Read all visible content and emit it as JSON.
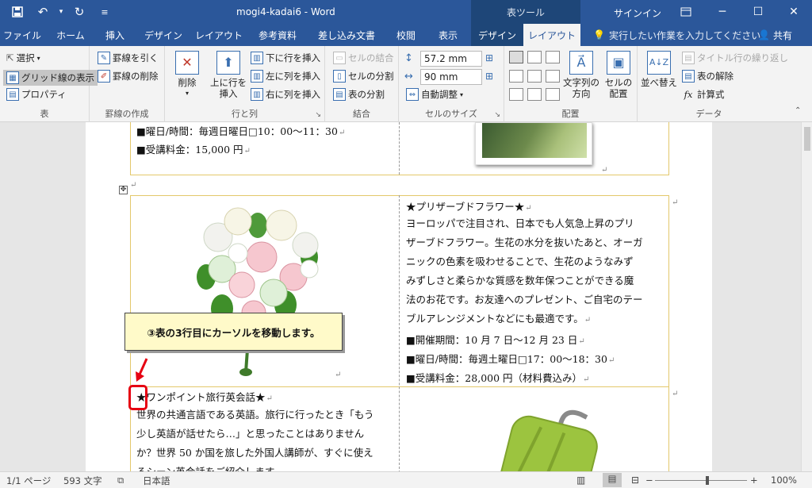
{
  "titlebar": {
    "doc_title": "mogi4-kadai6  -  Word",
    "context_group": "表ツール",
    "signin": "サインイン"
  },
  "tabs": [
    "ファイル",
    "ホーム",
    "挿入",
    "デザイン",
    "レイアウト",
    "参考資料",
    "差し込み文書",
    "校閲",
    "表示",
    "デザイン",
    "レイアウト"
  ],
  "tellme": "実行したい作業を入力してください",
  "share": "共有",
  "ribbon": {
    "table": {
      "label": "表",
      "select": "選択",
      "gridlines": "グリッド線の表示",
      "properties": "プロパティ"
    },
    "draw": {
      "label": "罫線の作成",
      "draw_table": "罫線を引く",
      "eraser": "罫線の削除"
    },
    "rowscols": {
      "label": "行と列",
      "delete": "削除",
      "insert_above_1": "上に行を",
      "insert_above_2": "挿入",
      "insert_below": "下に行を挿入",
      "insert_left": "左に列を挿入",
      "insert_right": "右に列を挿入"
    },
    "merge": {
      "label": "結合",
      "merge_cells": "セルの結合",
      "split_cells": "セルの分割",
      "split_table": "表の分割"
    },
    "cellsize": {
      "label": "セルのサイズ",
      "height": "57.2 mm",
      "width": "90 mm",
      "autofit": "自動調整"
    },
    "alignment": {
      "label": "配置",
      "text_direction_1": "文字列の",
      "text_direction_2": "方向",
      "cell_margins_1": "セルの",
      "cell_margins_2": "配置"
    },
    "data": {
      "label": "データ",
      "sort": "並べ替え",
      "repeat_header": "タイトル行の繰り返し",
      "convert": "表の解除",
      "formula": "計算式"
    }
  },
  "document": {
    "row1": {
      "line1": "■曜日/時間：毎週日曜日□10：00〜11：30",
      "line2": "■受講料金：15,000 円"
    },
    "row2": {
      "heading": "★プリザーブドフラワー★",
      "body": [
        "ヨーロッパで注目され、日本でも人気急上昇のプリ",
        "ザーブドフラワー。生花の水分を抜いたあと、オーガ",
        "ニックの色素を吸わせることで、生花のようなみず",
        "みずしさと柔らかな質感を数年保つことができる魔",
        "法のお花です。お友達へのプレゼント、ご自宅のテー",
        "ブルアレンジメントなどにも最適です。"
      ],
      "period": "■開催期間：10 月 7 日〜12 月 23 日",
      "time": "■曜日/時間：毎週土曜日□17：00〜18：30",
      "fee": "■受講料金：28,000 円（材料費込み）"
    },
    "row3": {
      "heading": "★ワンポイント旅行英会話★",
      "body": [
        "世界の共通言語である英語。旅行に行ったとき「もう",
        "少し英語が話せたら…」と思ったことはありません",
        "か？世界 50 か国を旅した外国人講師が、すぐに使え",
        "るシーン英会話をご紹介します。"
      ]
    },
    "callout": "③表の3行目にカーソルを移動します。"
  },
  "statusbar": {
    "page": "1/1 ページ",
    "words": "593 文字",
    "language": "日本語",
    "zoom": "100%"
  },
  "colors": {
    "title_bar": "#2b579a",
    "context_tab": "#1e4678",
    "table_border": "#e3c86b",
    "callout_bg": "#fffac9",
    "highlight": "#e60012"
  }
}
